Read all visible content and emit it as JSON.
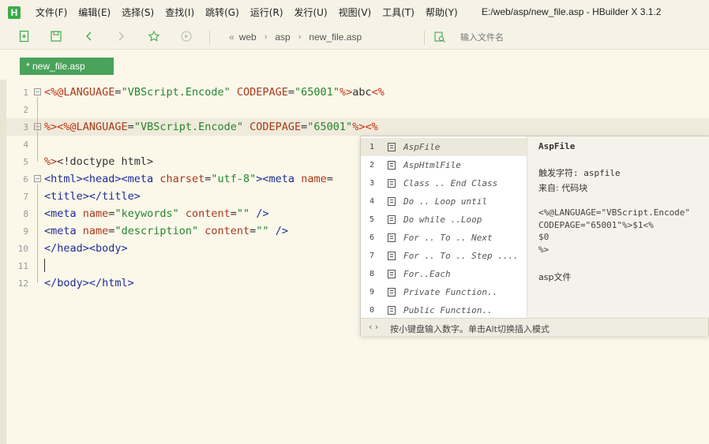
{
  "window": {
    "logo": "H",
    "title": "E:/web/asp/new_file.asp - HBuilder X 3.1.2"
  },
  "menu": [
    "文件(F)",
    "编辑(E)",
    "选择(S)",
    "查找(I)",
    "跳转(G)",
    "运行(R)",
    "发行(U)",
    "视图(V)",
    "工具(T)",
    "帮助(Y)"
  ],
  "breadcrumb": {
    "back": "«",
    "items": [
      "web",
      "asp",
      "new_file.asp"
    ],
    "separator": "›"
  },
  "file_search": {
    "placeholder": "输入文件名"
  },
  "tab": {
    "label": "* new_file.asp"
  },
  "editor": {
    "line_numbers": [
      "1",
      "2",
      "3",
      "4",
      "5",
      "6",
      "7",
      "8",
      "9",
      "10",
      "11",
      "12"
    ],
    "current_line": 3
  },
  "completion": {
    "items": [
      {
        "num": "1",
        "label": "AspFile"
      },
      {
        "num": "2",
        "label": "AspHtmlFile"
      },
      {
        "num": "3",
        "label": "Class .. End Class"
      },
      {
        "num": "4",
        "label": "Do .. Loop until"
      },
      {
        "num": "5",
        "label": "Do while ..Loop"
      },
      {
        "num": "6",
        "label": "For .. To .. Next"
      },
      {
        "num": "7",
        "label": "For .. To .. Step ...."
      },
      {
        "num": "8",
        "label": "For..Each"
      },
      {
        "num": "9",
        "label": "Private Function.."
      },
      {
        "num": "0",
        "label": "Public Function.."
      }
    ],
    "selected_index": 0,
    "detail": {
      "title": "AspFile",
      "trigger": "触发字符: aspfile",
      "from": "来自: 代码块",
      "snippet": "<%@LANGUAGE=\"VBScript.Encode\"\nCODEPAGE=\"65001\"%>$1<%\n$0\n%>",
      "description": "asp文件"
    },
    "footer_arrows": "‹ ›",
    "footer_hint": "按小键盘输入数字。单击Alt切换插入模式"
  },
  "colors": {
    "background": "#fbf8ea",
    "tab_active": "#4aa35a",
    "logo": "#3eaa4c",
    "current_line": "#efeadb"
  }
}
